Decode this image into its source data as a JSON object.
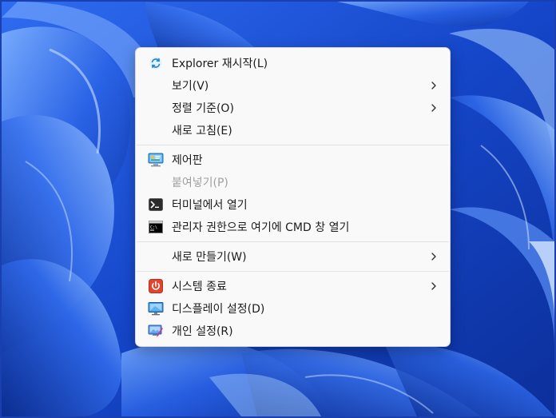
{
  "context_menu": {
    "groups": [
      {
        "items": [
          {
            "label": "Explorer 재시작(L)",
            "icon": "refresh-icon",
            "submenu": false,
            "disabled": false
          },
          {
            "label": "보기(V)",
            "icon": "",
            "submenu": true,
            "disabled": false
          },
          {
            "label": "정렬 기준(O)",
            "icon": "",
            "submenu": true,
            "disabled": false
          },
          {
            "label": "새로 고침(E)",
            "icon": "",
            "submenu": false,
            "disabled": false
          }
        ]
      },
      {
        "items": [
          {
            "label": "제어판",
            "icon": "control-panel-icon",
            "submenu": false,
            "disabled": false
          },
          {
            "label": "붙여넣기(P)",
            "icon": "",
            "submenu": false,
            "disabled": true
          },
          {
            "label": "터미널에서 열기",
            "icon": "terminal-icon",
            "submenu": false,
            "disabled": false
          },
          {
            "label": "관리자 권한으로 여기에 CMD 창 열기",
            "icon": "cmd-icon",
            "submenu": false,
            "disabled": false
          }
        ]
      },
      {
        "items": [
          {
            "label": "새로 만들기(W)",
            "icon": "",
            "submenu": true,
            "disabled": false
          }
        ]
      },
      {
        "items": [
          {
            "label": "시스템 종료",
            "icon": "power-icon",
            "submenu": true,
            "disabled": false
          },
          {
            "label": "디스플레이 설정(D)",
            "icon": "display-icon",
            "submenu": false,
            "disabled": false
          },
          {
            "label": "개인 설정(R)",
            "icon": "personalize-icon",
            "submenu": false,
            "disabled": false
          }
        ]
      }
    ]
  },
  "colors": {
    "menu_background": "#f9f9f9",
    "wallpaper_base": "#1b4fd8",
    "text": "#1b1b1b",
    "disabled_text": "#a0a0a0",
    "power_red": "#e0452e"
  }
}
